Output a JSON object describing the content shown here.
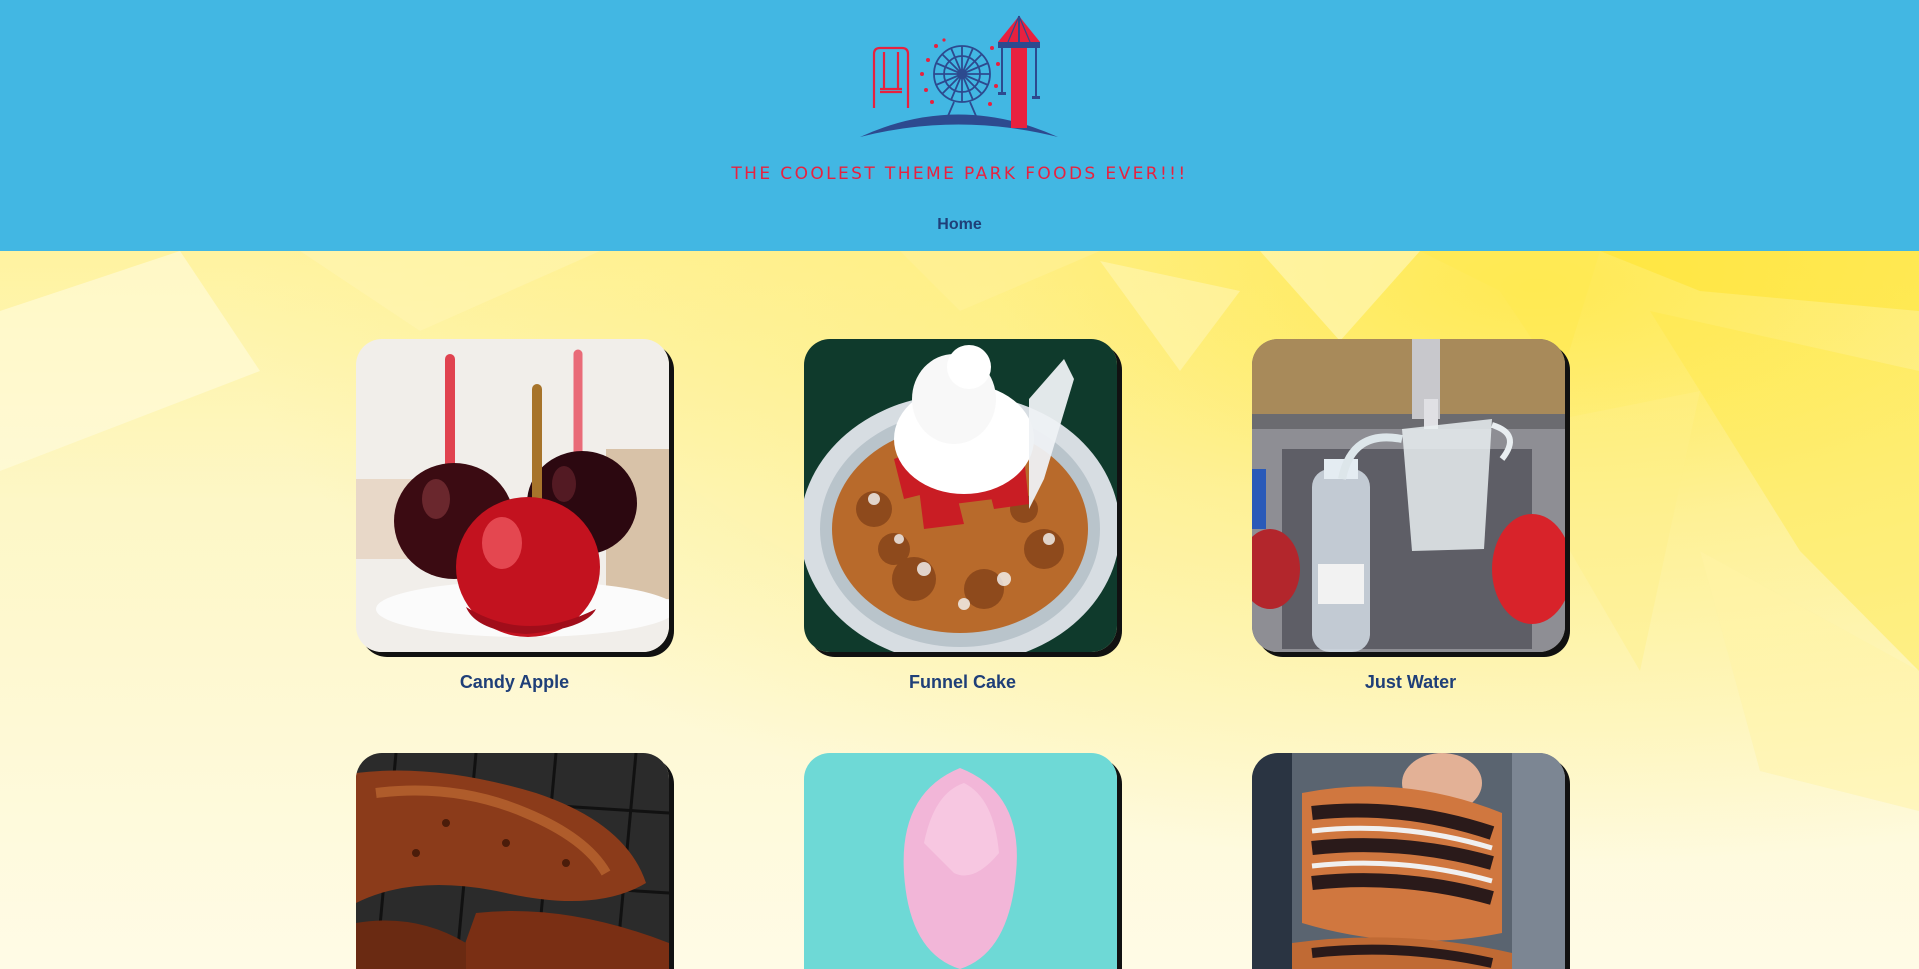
{
  "header": {
    "tagline": "THE COOLEST THEME PARK FOODS EVER!!!",
    "logo_icon": "theme-park-logo-icon"
  },
  "nav": {
    "items": [
      {
        "label": "Home"
      }
    ]
  },
  "colors": {
    "header_bg": "#42b7e3",
    "tagline": "#e8213f",
    "nav_text": "#1f3f78",
    "caption": "#1f3f78"
  },
  "foods": [
    {
      "name": "Candy Apple"
    },
    {
      "name": "Funnel Cake"
    },
    {
      "name": "Just Water"
    },
    {
      "name": ""
    },
    {
      "name": ""
    },
    {
      "name": ""
    }
  ]
}
